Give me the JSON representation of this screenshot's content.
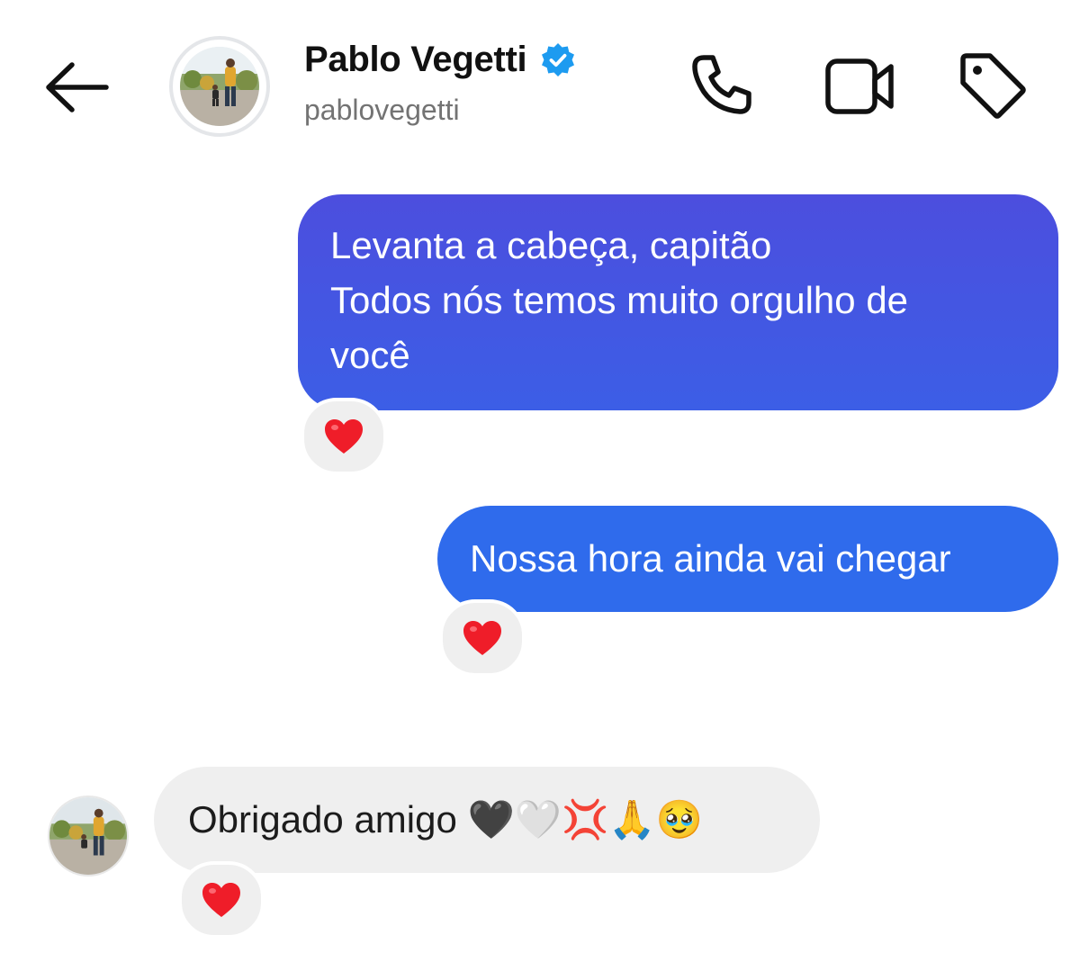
{
  "header": {
    "contact_name": "Pablo Vegetti",
    "username": "pablovegetti",
    "verified": true,
    "icons": {
      "back": "arrow-left-icon",
      "call": "phone-icon",
      "video": "video-camera-icon",
      "tag": "tag-icon",
      "verified": "verified-badge-icon"
    }
  },
  "messages": [
    {
      "sender": "me",
      "lines": [
        "Levanta a cabeça, capitão",
        "Todos nós temos muito orgulho de",
        "você"
      ],
      "reaction": "❤️"
    },
    {
      "sender": "me",
      "text": "Nossa hora ainda vai chegar",
      "reaction": "❤️"
    },
    {
      "sender": "contact",
      "text": "Obrigado amigo 🖤🤍💢🙏🥹",
      "reaction": "❤️"
    }
  ],
  "colors": {
    "bubble_gradient_top": "#4c4ede",
    "bubble_gradient_bottom": "#3c5ee6",
    "bubble_blue": "#2f6bec",
    "bubble_gray": "#efefef",
    "verified_blue": "#1d9bf0"
  }
}
